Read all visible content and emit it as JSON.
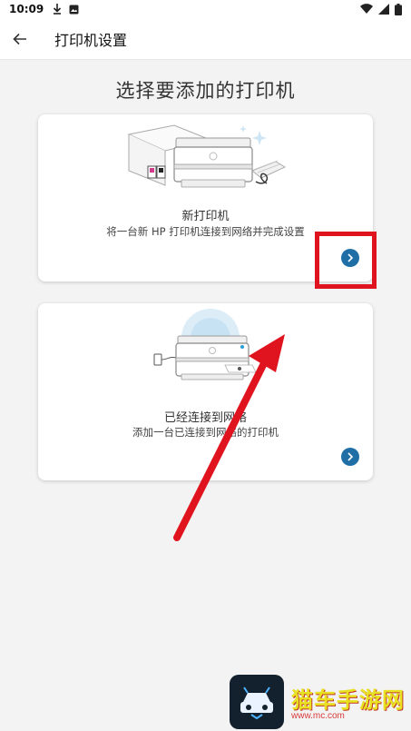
{
  "status_bar": {
    "time": "10:09"
  },
  "app_bar": {
    "title": "打印机设置"
  },
  "heading": "选择要添加的打印机",
  "cards": [
    {
      "title": "新打印机",
      "subtitle": "将一台新 HP 打印机连接到网络并完成设置"
    },
    {
      "title": "已经连接到网络",
      "subtitle": "添加一台已连接到网络的打印机"
    }
  ],
  "watermark": {
    "text": "猫车手游网",
    "url": "www.mc.com"
  },
  "colors": {
    "accent": "#1f6fa6",
    "highlight": "#e0141e",
    "background": "#f3f3f3"
  }
}
